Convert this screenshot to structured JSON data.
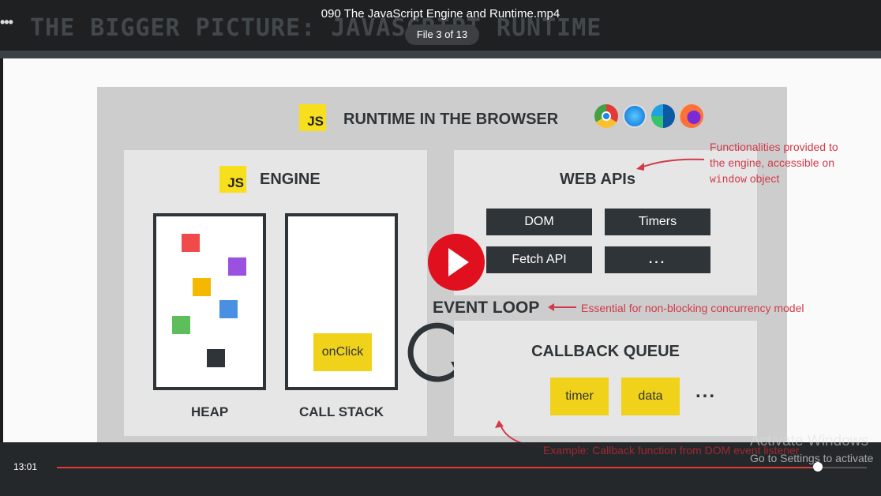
{
  "player": {
    "file_name": "090 The JavaScript Engine and Runtime.mp4",
    "file_count": "File 3 of 13",
    "current_time": "13:01",
    "progress_fraction": 0.94
  },
  "slide": {
    "title": "THE BIGGER PICTURE: JAVASCRIPT RUNTIME",
    "js_badge": "JS",
    "runtime_heading": "RUNTIME IN THE BROWSER",
    "browsers": [
      {
        "name": "chrome-icon",
        "color": "#e53935"
      },
      {
        "name": "safari-icon",
        "color": "#1e88e5"
      },
      {
        "name": "edge-icon",
        "color": "#0078d4"
      },
      {
        "name": "firefox-icon",
        "color": "#ff7139"
      }
    ],
    "engine": {
      "heading": "ENGINE",
      "heap_label": "HEAP",
      "call_stack_label": "CALL STACK",
      "stack_item": "onClick",
      "heap_colors": [
        "#f04a4a",
        "#9b51e0",
        "#f5b800",
        "#4a90e2",
        "#5cbf5c",
        "#2f3438"
      ]
    },
    "web_apis": {
      "heading": "WEB APIs",
      "items": [
        "DOM",
        "Timers",
        "Fetch API",
        "..."
      ]
    },
    "event_loop": "EVENT LOOP",
    "callback_queue": {
      "heading": "CALLBACK QUEUE",
      "items": [
        "timer",
        "data"
      ],
      "more": "..."
    },
    "notes": {
      "web_apis_line1": "Functionalities provided to",
      "web_apis_line2": "the engine, accessible on",
      "web_apis_mono": "window",
      "web_apis_line3_rest": " object",
      "event_loop": "Essential for non-blocking concurrency model",
      "callback": "Example: Callback function from DOM event listener"
    },
    "accent_color": "#d23a4a"
  },
  "watermark": {
    "line1": "Activate Windows",
    "line2": "Go to Settings to activate"
  }
}
